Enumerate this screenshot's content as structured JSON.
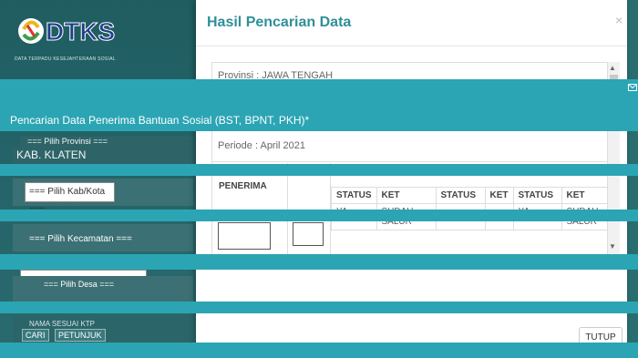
{
  "background": {
    "logo_text": "DTKS",
    "logo_sub": "DATA TERPADU KESEJAHTERAAN SOSIAL",
    "heading": "Pencarian Data Penerima Bantuan Sosial (BST, BPNT, PKH)*",
    "fields": {
      "provinsi_placeholder": "=== Pilih Provinsi ===",
      "kab_value": "KAB. KLATEN",
      "kab_placeholder": "=== Pilih Kab/Kota ===",
      "kec_placeholder": "=== Pilih Kecamatan ===",
      "desa_placeholder": "=== Pilih Desa ===",
      "nama_placeholder": "NAMA SESUAI KTP"
    },
    "buttons": {
      "cari": "CARI",
      "petunjuk": "PETUNJUK"
    }
  },
  "modal": {
    "title": "Hasil Pencarian Data",
    "close": "×",
    "provinsi": "Provinsi : JAWA TENGAH",
    "periode": "Periode : April 2021",
    "table": {
      "penerima_header": "PENERIMA",
      "sub_headers": [
        "STATUS",
        "KET",
        "STATUS",
        "KET",
        "STATUS",
        "KET"
      ],
      "row": [
        "YA",
        "SUDAH SALUR",
        "-",
        "-",
        "YA",
        "SUDAH SALUR"
      ]
    },
    "tutup_label": "TUTUP"
  },
  "colors": {
    "accent": "#2ba5b4",
    "title": "#2f8f99",
    "bg": "#2b6f73"
  },
  "icons": {
    "mail": "mail-icon",
    "close": "close-icon"
  }
}
